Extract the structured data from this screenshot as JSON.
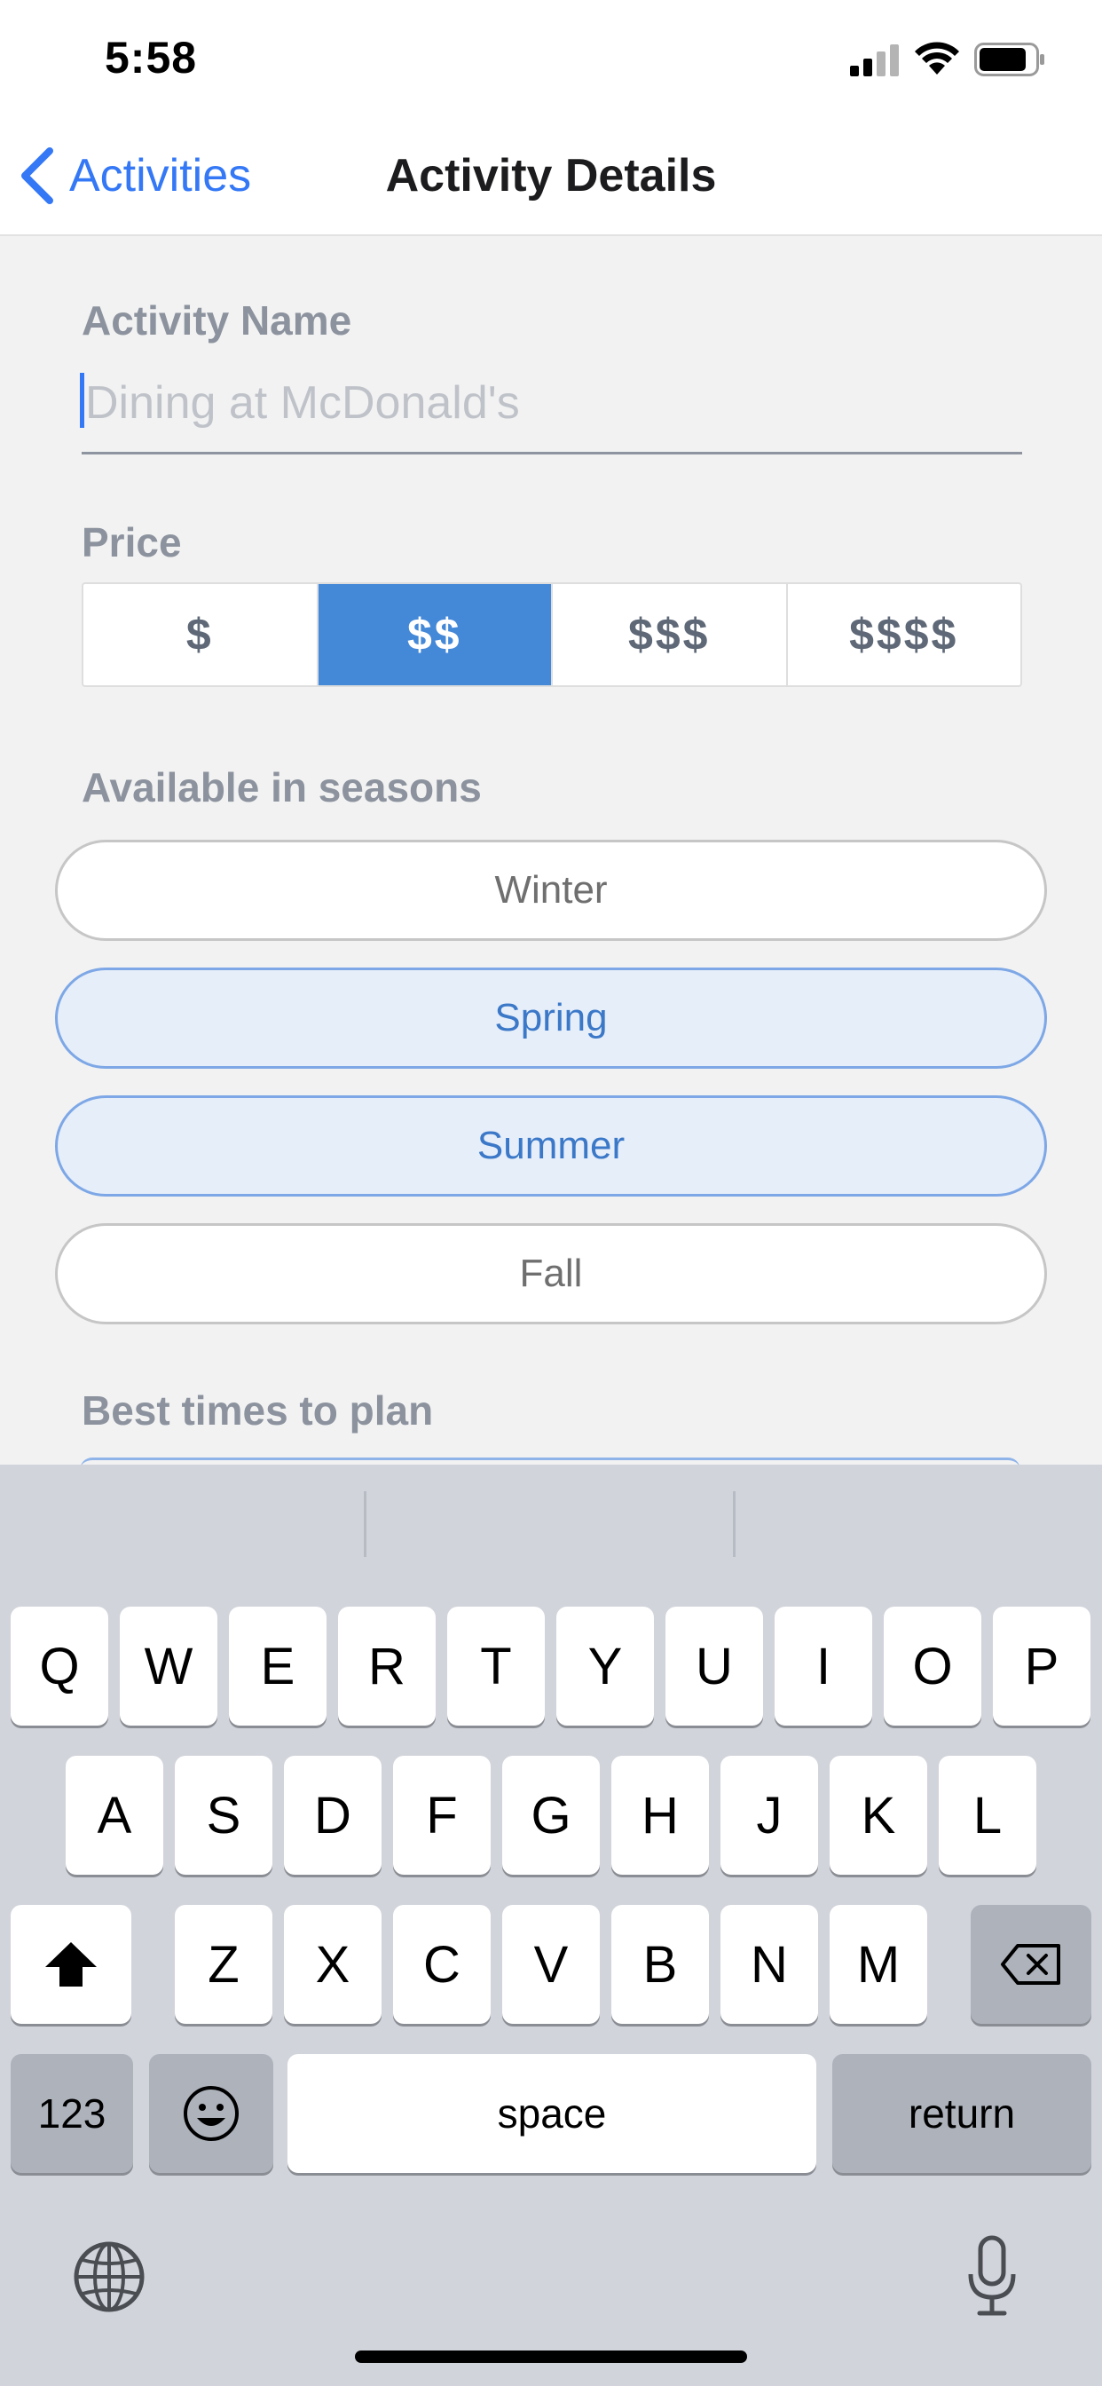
{
  "status_bar": {
    "time": "5:58",
    "signal_icon": "cellular-signal-icon",
    "wifi_icon": "wifi-icon",
    "battery_icon": "battery-icon"
  },
  "nav": {
    "back_label": "Activities",
    "back_icon": "chevron-left-icon",
    "title": "Activity Details"
  },
  "form": {
    "activity_name": {
      "label": "Activity Name",
      "value": "",
      "placeholder": "Dining at McDonald's"
    },
    "price": {
      "label": "Price",
      "options": [
        "$",
        "$$",
        "$$$",
        "$$$$"
      ],
      "selected": "$$"
    },
    "seasons": {
      "label": "Available in seasons",
      "options": [
        {
          "label": "Winter",
          "selected": false
        },
        {
          "label": "Spring",
          "selected": true
        },
        {
          "label": "Summer",
          "selected": true
        },
        {
          "label": "Fall",
          "selected": false
        }
      ]
    },
    "best_times": {
      "label": "Best times to plan"
    }
  },
  "keyboard": {
    "row1": [
      "Q",
      "W",
      "E",
      "R",
      "T",
      "Y",
      "U",
      "I",
      "O",
      "P"
    ],
    "row2": [
      "A",
      "S",
      "D",
      "F",
      "G",
      "H",
      "J",
      "K",
      "L"
    ],
    "row3": [
      "Z",
      "X",
      "C",
      "V",
      "B",
      "N",
      "M"
    ],
    "numbers_key": "123",
    "space_key": "space",
    "return_key": "return",
    "shift_icon": "shift-icon",
    "delete_icon": "delete-icon",
    "emoji_icon": "emoji-icon",
    "globe_icon": "globe-icon",
    "mic_icon": "microphone-icon"
  },
  "colors": {
    "accent": "#3478f6",
    "segment_selected": "#4488d8",
    "season_selected_bg": "#e5eef9",
    "keyboard_bg": "#d1d4db"
  }
}
